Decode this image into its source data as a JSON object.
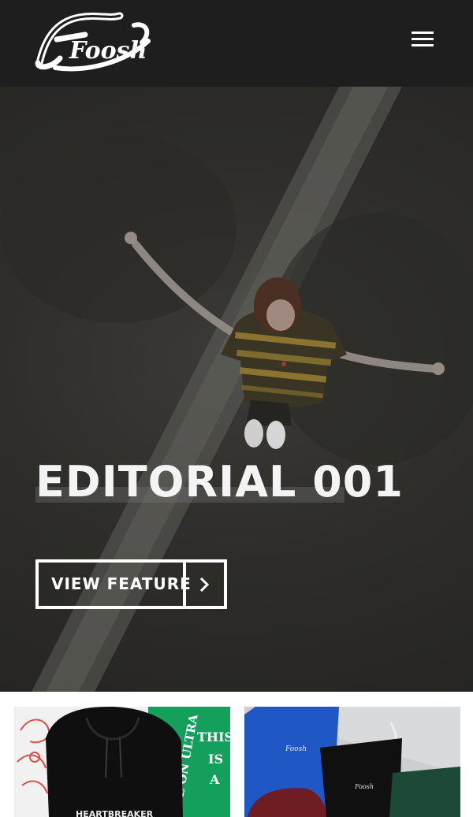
{
  "brand": {
    "logo_text": "Foosh",
    "logo_icon": "foosh-script-logo"
  },
  "header": {
    "menu_icon": "hamburger-menu-icon",
    "bg_color": "#1e1e1e"
  },
  "hero": {
    "title": "EDITORIAL 001",
    "cta_label": "VIEW FEATURE",
    "cta_icon": "chevron-right-icon"
  },
  "tiles": [
    {
      "name": "hoodie-product-tile",
      "graphic_text": [
        "BE ON ULTRA",
        "THIS",
        "IS",
        "A"
      ],
      "garment_text": "HEARTBREAKER"
    },
    {
      "name": "tees-product-tile",
      "garment_text": "Foosh"
    }
  ]
}
